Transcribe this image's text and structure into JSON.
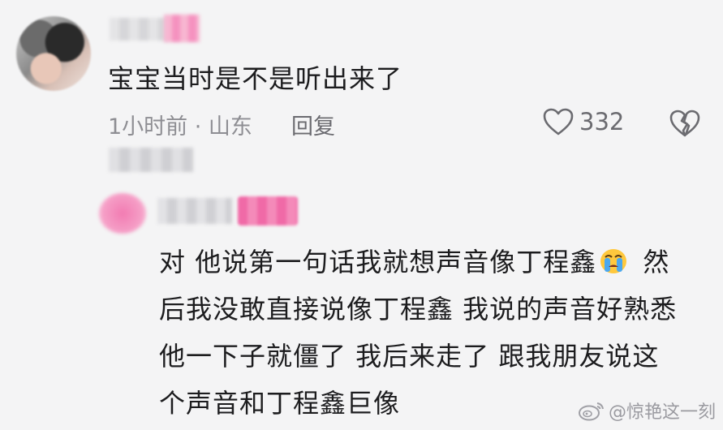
{
  "comment": {
    "text": "宝宝当时是不是听出来了",
    "time_location": "1小时前 · 山东",
    "reply_label": "回复",
    "like_count": "332"
  },
  "reply": {
    "lines": [
      "他说第一句话我就想声音像丁程鑫",
      "然",
      "后我没敢直接说像丁程鑫 我说的声音好熟悉",
      "他一下子就僵了 我后来走了 跟我朋友说这",
      "个声音和丁程鑫巨像"
    ],
    "line1_prefix": "对"
  },
  "watermark": {
    "text": "@惊艳这一刻"
  },
  "icons": {
    "like": "heart-icon",
    "dislike": "broken-heart-icon",
    "emoji": "crying-face-emoji-icon",
    "watermark_logo": "weibo-logo-icon"
  }
}
